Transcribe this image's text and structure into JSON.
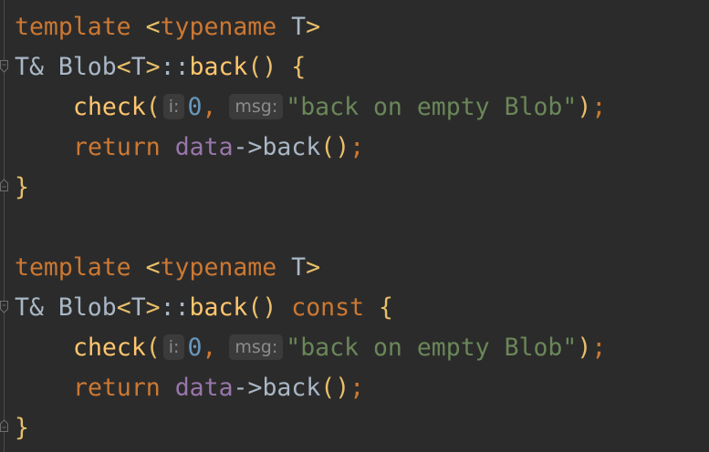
{
  "code": {
    "block1": {
      "line1": {
        "template": "template",
        "open": "<",
        "typename": "typename",
        "param": " T",
        "close": ">"
      },
      "line2": {
        "ret": "T&",
        "cls": "Blob",
        "targs_open": "<",
        "targs": "T",
        "targs_close": ">",
        "scope": "::",
        "fn": "back",
        "parens": "()",
        "brace": "{"
      },
      "line3": {
        "fn": "check",
        "paren_open": "(",
        "hint_i": "i:",
        "arg0": "0",
        "comma": ",",
        "hint_msg": "msg:",
        "arg1": "\"back on empty Blob\"",
        "paren_close": ")",
        "semi": ";"
      },
      "line4": {
        "kw": "return",
        "field": "data",
        "arrow": "->",
        "fn": "back",
        "parens": "()",
        "semi": ";"
      },
      "line5": {
        "brace": "}"
      }
    },
    "block2": {
      "line1": {
        "template": "template",
        "open": "<",
        "typename": "typename",
        "param": " T",
        "close": ">"
      },
      "line2": {
        "ret": "T&",
        "cls": "Blob",
        "targs_open": "<",
        "targs": "T",
        "targs_close": ">",
        "scope": "::",
        "fn": "back",
        "parens": "()",
        "const": "const",
        "brace": "{"
      },
      "line3": {
        "fn": "check",
        "paren_open": "(",
        "hint_i": "i:",
        "arg0": "0",
        "comma": ",",
        "hint_msg": "msg:",
        "arg1": "\"back on empty Blob\"",
        "paren_close": ")",
        "semi": ";"
      },
      "line4": {
        "kw": "return",
        "field": "data",
        "arrow": "->",
        "fn": "back",
        "parens": "()",
        "semi": ";"
      },
      "line5": {
        "brace": "}"
      }
    }
  },
  "colors": {
    "background": "#2b2b2b",
    "keyword": "#cc7832",
    "function": "#ffc66d",
    "string": "#6a8759",
    "number": "#6897bb",
    "field": "#9876aa",
    "text": "#a9b7c6",
    "hint_bg": "#3b3b3b",
    "hint_text": "#8c8c8c"
  },
  "icons": {
    "fold_open": "fold-open-icon",
    "fold_close": "fold-close-icon"
  }
}
